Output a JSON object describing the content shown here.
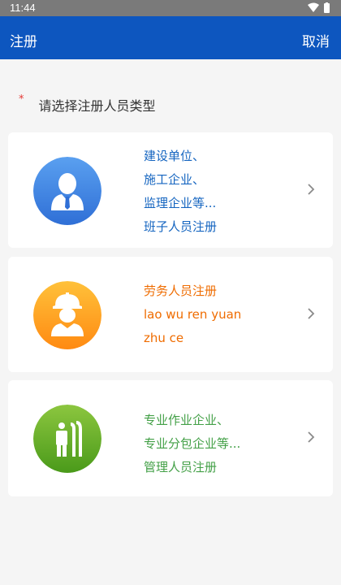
{
  "status_bar": {
    "time": "11:44"
  },
  "app_bar": {
    "title": "注册",
    "cancel_label": "取消"
  },
  "section": {
    "required_mark": "*",
    "label": "请选择注册人员类型"
  },
  "cards": [
    {
      "lines": [
        "建设单位、",
        "施工企业、",
        "监理企业等...",
        "班子人员注册"
      ],
      "color": "#1565c0",
      "icon": "manager-icon"
    },
    {
      "lines": [
        "劳务人员注册",
        "lao wu ren yuan",
        "zhu ce"
      ],
      "color": "#ef6c00",
      "icon": "worker-helmet-icon"
    },
    {
      "lines": [
        "专业作业企业、",
        "专业分包企业等...",
        "管理人员注册"
      ],
      "color": "#43a047",
      "icon": "specialist-staff-icon"
    }
  ],
  "colors": {
    "app_bar": "#0d56bf",
    "background": "#f5f5f5"
  }
}
